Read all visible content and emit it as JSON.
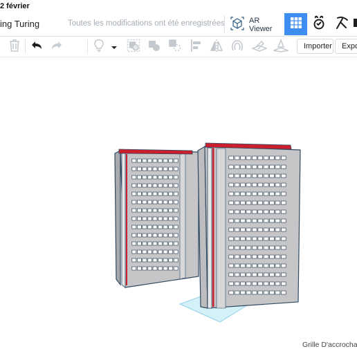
{
  "status_bar": {
    "date": "2 février"
  },
  "header": {
    "design_title": "ing Turing",
    "save_status": "Toutes les modifications ont été enregistrées",
    "ar_viewer_label": "AR Viewer"
  },
  "header_buttons": [
    {
      "icon": "grid-view-icon",
      "active": true
    },
    {
      "icon": "blocks-icon",
      "active": false
    },
    {
      "icon": "bricks-icon",
      "active": false
    }
  ],
  "toolbar": {
    "icons": [
      "delete-icon",
      "undo-icon",
      "redo-icon",
      "light-bulb-icon",
      "dropdown-icon",
      "group-icon",
      "ungroup-icon",
      "align-icon",
      "mirror-icon",
      "workplane-icon",
      "ruler-icon",
      "note-icon"
    ],
    "import_label": "Importer",
    "export_label": "Expor"
  },
  "workplane": {
    "snap_grid_label": "Grille D'accrocha"
  },
  "colors": {
    "accent": "#3d8ef0",
    "building_face": "#c6c6c8",
    "building_edge": "#2f4a62",
    "roof_red": "#cc1f2d",
    "workplane_tint": "#d4f1f8"
  }
}
